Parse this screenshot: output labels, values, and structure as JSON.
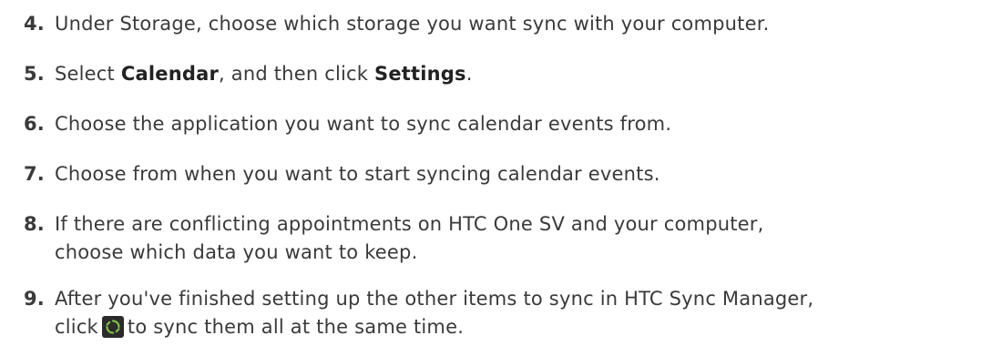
{
  "steps": [
    {
      "number": "4.",
      "text": "Under Storage, choose which storage you want sync with your computer."
    },
    {
      "number": "5.",
      "text_before": "Select ",
      "keyword1": "Calendar",
      "text_middle": ", and then click ",
      "keyword2": "Settings",
      "text_after": "."
    },
    {
      "number": "6.",
      "text": "Choose the application you want to sync calendar events from."
    },
    {
      "number": "7.",
      "text": "Choose from when you want to start syncing calendar events."
    },
    {
      "number": "8.",
      "line1": "If there are conflicting appointments on HTC One SV and your computer,",
      "line2": "choose which data you want to keep."
    },
    {
      "number": "9.",
      "line1": "After you've finished setting up the other items to sync in HTC Sync Manager,",
      "line2_before": "click",
      "icon": "sync-icon",
      "line2_after": "to sync them all at the same time."
    }
  ],
  "colors": {
    "text": "#3a3a3a",
    "icon_bg": "#2b2b2b",
    "icon_fg": "#7cc242"
  }
}
